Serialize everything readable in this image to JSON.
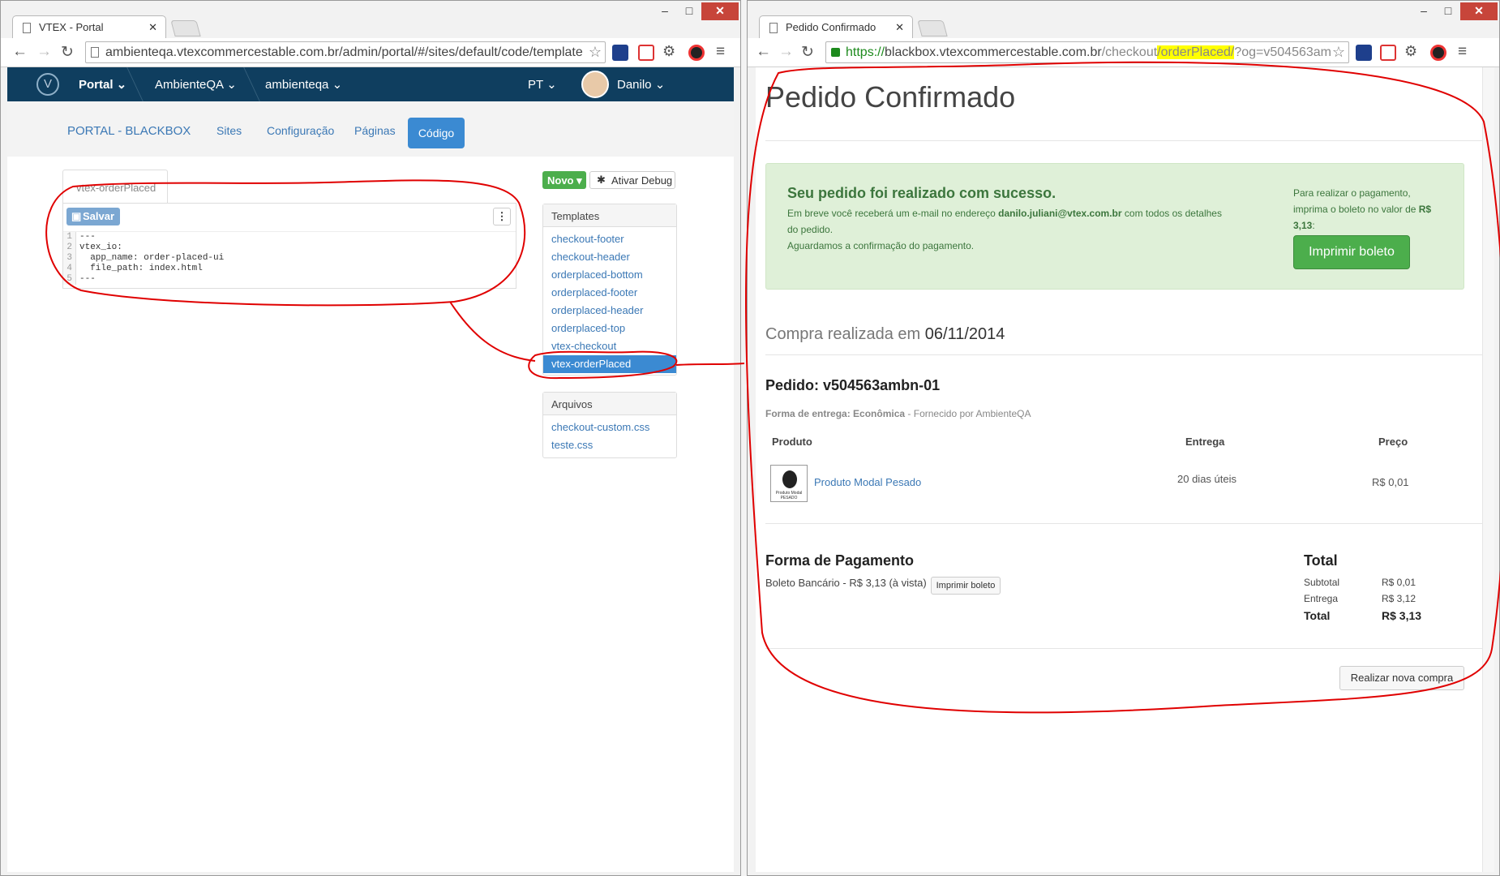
{
  "left": {
    "tab_title": "VTEX - Portal",
    "url": "ambienteqa.vtexcommercestable.com.br/admin/portal/#/sites/default/code/template",
    "nav": {
      "portal": "Portal",
      "account": "AmbienteQA",
      "store": "ambienteqa",
      "lang": "PT",
      "user": "Danilo"
    },
    "subnav": {
      "brand": "PORTAL - BLACKBOX",
      "sites": "Sites",
      "config": "Configuração",
      "pages": "Páginas",
      "code": "Código"
    },
    "editor_tab": "vtex-orderPlaced",
    "save": "Salvar",
    "code_lines": [
      "---",
      "vtex_io:",
      "  app_name: order-placed-ui",
      "  file_path: index.html",
      "---"
    ],
    "new_btn": "Novo",
    "debug_btn": "Ativar Debug",
    "templates_title": "Templates",
    "templates": [
      "checkout-footer",
      "checkout-header",
      "orderplaced-bottom",
      "orderplaced-footer",
      "orderplaced-header",
      "orderplaced-top",
      "vtex-checkout",
      "vtex-orderPlaced"
    ],
    "files_title": "Arquivos",
    "files": [
      "checkout-custom.css",
      "teste.css"
    ]
  },
  "right": {
    "tab_title": "Pedido Confirmado",
    "url_https": "https://",
    "url_host": "blackbox.vtexcommercestable.com.br",
    "url_path": "/checkout",
    "url_highlight": "/orderPlaced/",
    "url_query": "?og=v504563am",
    "title": "Pedido Confirmado",
    "alert": {
      "heading": "Seu pedido foi realizado com sucesso.",
      "line1_pre": "Em breve você receberá um e-mail no endereço",
      "email": "danilo.juliani@vtex.com.br",
      "line1_post": "com todos os detalhes",
      "line2": "do pedido.",
      "line3": "Aguardamos a confirmação do pagamento.",
      "side_l1": "Para realizar o pagamento,",
      "side_l2": "imprima o boleto no valor de",
      "side_amount": "R$ 3,13",
      "button": "Imprimir boleto"
    },
    "purchase_label": "Compra realizada em",
    "purchase_date": "06/11/2014",
    "order_label": "Pedido: v504563ambn-01",
    "delivery_label": "Forma de entrega:",
    "delivery_value": "Econômica",
    "supplier": "- Fornecido por AmbienteQA",
    "table_headers": {
      "product": "Produto",
      "delivery": "Entrega",
      "price": "Preço"
    },
    "item": {
      "name": "Produto Modal Pesado",
      "delivery": "20 dias úteis",
      "price": "R$ 0,01",
      "thumb_l1": "Produto Modal",
      "thumb_l2": "PESADO"
    },
    "payment_title": "Forma de Pagamento",
    "payment_desc": "Boleto Bancário - R$ 3,13 (à vista)",
    "payment_btn": "Imprimir boleto",
    "total_title": "Total",
    "totals": [
      {
        "label": "Subtotal",
        "value": "R$ 0,01"
      },
      {
        "label": "Entrega",
        "value": "R$ 3,12"
      },
      {
        "label": "Total",
        "value": "R$ 3,13"
      }
    ],
    "new_purchase": "Realizar nova compra"
  },
  "colors": {
    "nav_bg": "#0f3e5f",
    "accent": "#3b8ad2",
    "success": "#4cae4c",
    "annotation": "#e00000",
    "highlight": "#ffff00"
  }
}
